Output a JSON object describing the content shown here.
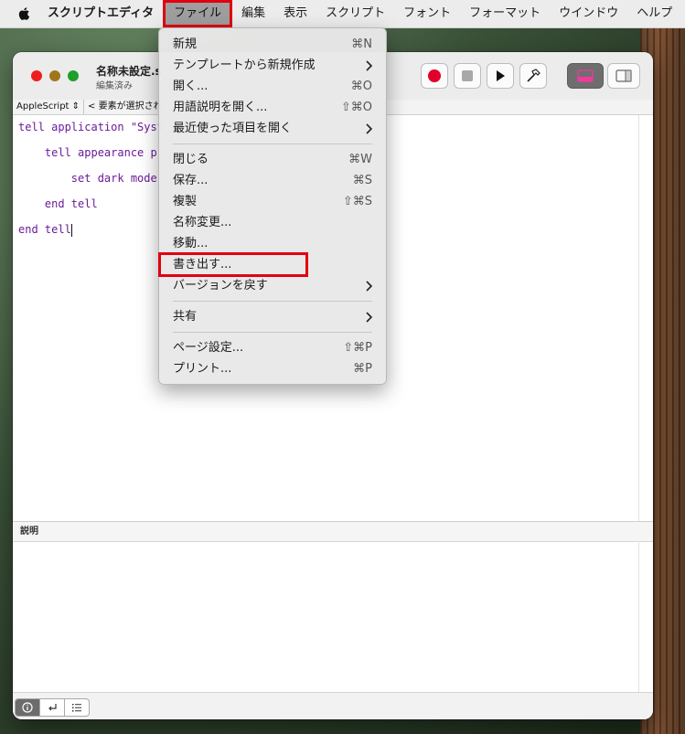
{
  "menubar": {
    "app_name": "スクリプトエディタ",
    "items": [
      "ファイル",
      "編集",
      "表示",
      "スクリプト",
      "フォント",
      "フォーマット",
      "ウインドウ",
      "ヘルプ"
    ]
  },
  "window": {
    "title": "名称未設定.s",
    "subtitle": "編集済み",
    "nav_language": "AppleScript ⇕",
    "nav_element": "< 要素が選択され",
    "description_label": "説明"
  },
  "code": [
    "tell application \"Syst",
    "    tell appearance p",
    "        set dark mode",
    "    end tell",
    "end tell"
  ],
  "file_menu": {
    "items": [
      {
        "label": "新規",
        "shortcut": "⌘N"
      },
      {
        "label": "テンプレートから新規作成",
        "shortcut": ""
      },
      {
        "label": "開く...",
        "shortcut": "⌘O"
      },
      {
        "label": "用語説明を開く...",
        "shortcut": "⇧⌘O"
      },
      {
        "label": "最近使った項目を開く",
        "shortcut": ""
      },
      {
        "label": "閉じる",
        "shortcut": "⌘W"
      },
      {
        "label": "保存...",
        "shortcut": "⌘S"
      },
      {
        "label": "複製",
        "shortcut": "⇧⌘S"
      },
      {
        "label": "名称変更...",
        "shortcut": ""
      },
      {
        "label": "移動...",
        "shortcut": ""
      },
      {
        "label": "書き出す...",
        "shortcut": ""
      },
      {
        "label": "バージョンを戻す",
        "shortcut": ""
      },
      {
        "label": "共有",
        "shortcut": ""
      },
      {
        "label": "ページ設定...",
        "shortcut": "⇧⌘P"
      },
      {
        "label": "プリント...",
        "shortcut": "⌘P"
      }
    ]
  },
  "colors": {
    "highlight_box": "#e00010",
    "code_text": "#6a1b9a",
    "record_button": "#e0002a"
  }
}
